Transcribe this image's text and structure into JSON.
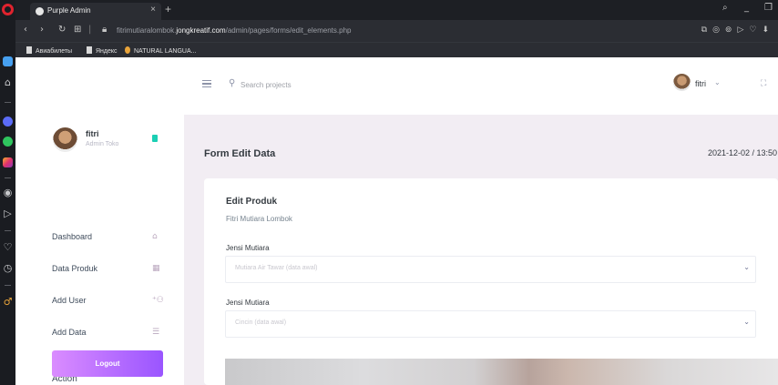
{
  "browser": {
    "tab_title": "Purple Admin",
    "tab_close": "×",
    "tab_new": "+",
    "url_prefix": "fitrimutiaralombok.",
    "url_domain": "jongkreatif.com",
    "url_path": "/admin/pages/forms/edit_elements.php",
    "bookmarks": [
      {
        "label": "Авиабилеты",
        "icon": "bookmark-icon"
      },
      {
        "label": "Яндекс",
        "icon": "bookmark-icon"
      },
      {
        "label": "NATURAL LANGUA...",
        "icon": "globe-icon"
      }
    ]
  },
  "navbar": {
    "search_placeholder": "Search projects",
    "user_name": "fitri",
    "user_chevron": "⌄"
  },
  "sidebar": {
    "profile_name": "fitri",
    "profile_role": "Admin Toko",
    "items": [
      {
        "label": "Dashboard",
        "icon": "home-icon"
      },
      {
        "label": "Data Produk",
        "icon": "table-icon"
      },
      {
        "label": "Add User",
        "icon": "add-user-icon"
      },
      {
        "label": "Add Data",
        "icon": "list-icon"
      }
    ],
    "action_label": "Action",
    "logout_label": "Logout"
  },
  "content": {
    "page_title": "Form Edit Data",
    "datetime": "2021-12-02 / 13:50",
    "card_title": "Edit Produk",
    "card_subtitle": "Fitri Mutiara Lombok",
    "fields": [
      {
        "label": "Jensi Mutiara",
        "value": "Mutiara Air Tawar (data awal)"
      },
      {
        "label": "Jensi Mutiara",
        "value": "Cincin (data awal)"
      }
    ]
  },
  "colors": {
    "accent_gradient_start": "#da8cff",
    "accent_gradient_end": "#9a55ff",
    "page_background": "#f2edf3",
    "badge": "#1bcfb4"
  }
}
